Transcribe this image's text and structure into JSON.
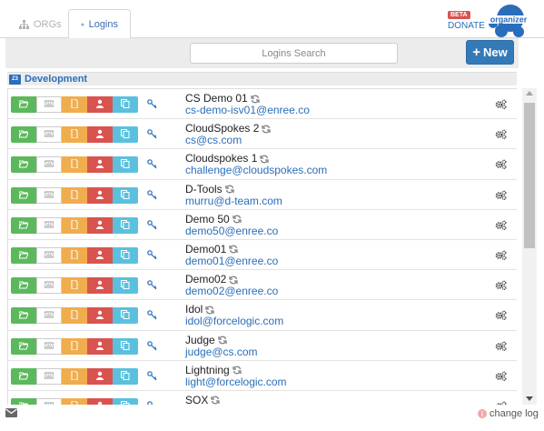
{
  "tabs": [
    {
      "label": "ORGs",
      "icon": "sitemap-icon",
      "active": false
    },
    {
      "label": "Logins",
      "icon": "users-icon",
      "active": true
    }
  ],
  "header": {
    "beta": "BETA",
    "donate": "DONATE",
    "logo_text": "organizer"
  },
  "toolbar": {
    "search_placeholder": "Logins Search",
    "new_label": "New"
  },
  "group": {
    "icon_text": "Z3",
    "label": "Development"
  },
  "rows": [
    {
      "name": "CS Demo 01",
      "user": "cs-demo-isv01@enree.co"
    },
    {
      "name": "CloudSpokes 2",
      "user": "cs@cs.com"
    },
    {
      "name": "Cloudspokes 1",
      "user": "challenge@cloudspokes.com"
    },
    {
      "name": "D-Tools",
      "user": "murru@d-team.com"
    },
    {
      "name": "Demo 50",
      "user": "demo50@enree.co"
    },
    {
      "name": "Demo01",
      "user": "demo01@enree.co"
    },
    {
      "name": "Demo02",
      "user": "demo02@enree.co"
    },
    {
      "name": "Idol",
      "user": "idol@forcelogic.com"
    },
    {
      "name": "Judge",
      "user": "judge@cs.com"
    },
    {
      "name": "Lightning",
      "user": "light@forcelogic.com"
    },
    {
      "name": "SOX",
      "user": ""
    }
  ],
  "footer": {
    "change_log": "change log"
  },
  "colors": {
    "green": "#5cb85c",
    "orange": "#f0ad4e",
    "red": "#d9534f",
    "cyan": "#5bc0de",
    "blue": "#2a6ebb",
    "primary": "#337ab7"
  }
}
